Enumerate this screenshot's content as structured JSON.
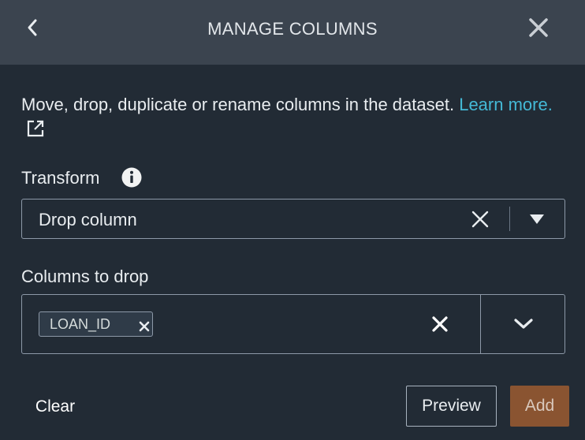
{
  "header": {
    "title": "MANAGE COLUMNS"
  },
  "description": {
    "text": "Move, drop, duplicate or rename columns in the dataset. ",
    "link_text": "Learn more."
  },
  "transform": {
    "label": "Transform",
    "value": "Drop column"
  },
  "columns_to_drop": {
    "label": "Columns to drop",
    "tokens": [
      "LOAN_ID"
    ]
  },
  "footer": {
    "clear_label": "Clear",
    "preview_label": "Preview",
    "add_label": "Add"
  },
  "colors": {
    "accent_link": "#44b9d6",
    "add_button": "#8a5431",
    "header_bg": "#3b444f",
    "panel_bg": "#222b35"
  },
  "icons": {
    "back": "chevron-left-icon",
    "close": "close-icon",
    "external": "external-link-icon",
    "info": "info-icon",
    "clear": "clear-icon",
    "dropdown": "caret-down-icon",
    "expand": "chevron-down-icon"
  }
}
